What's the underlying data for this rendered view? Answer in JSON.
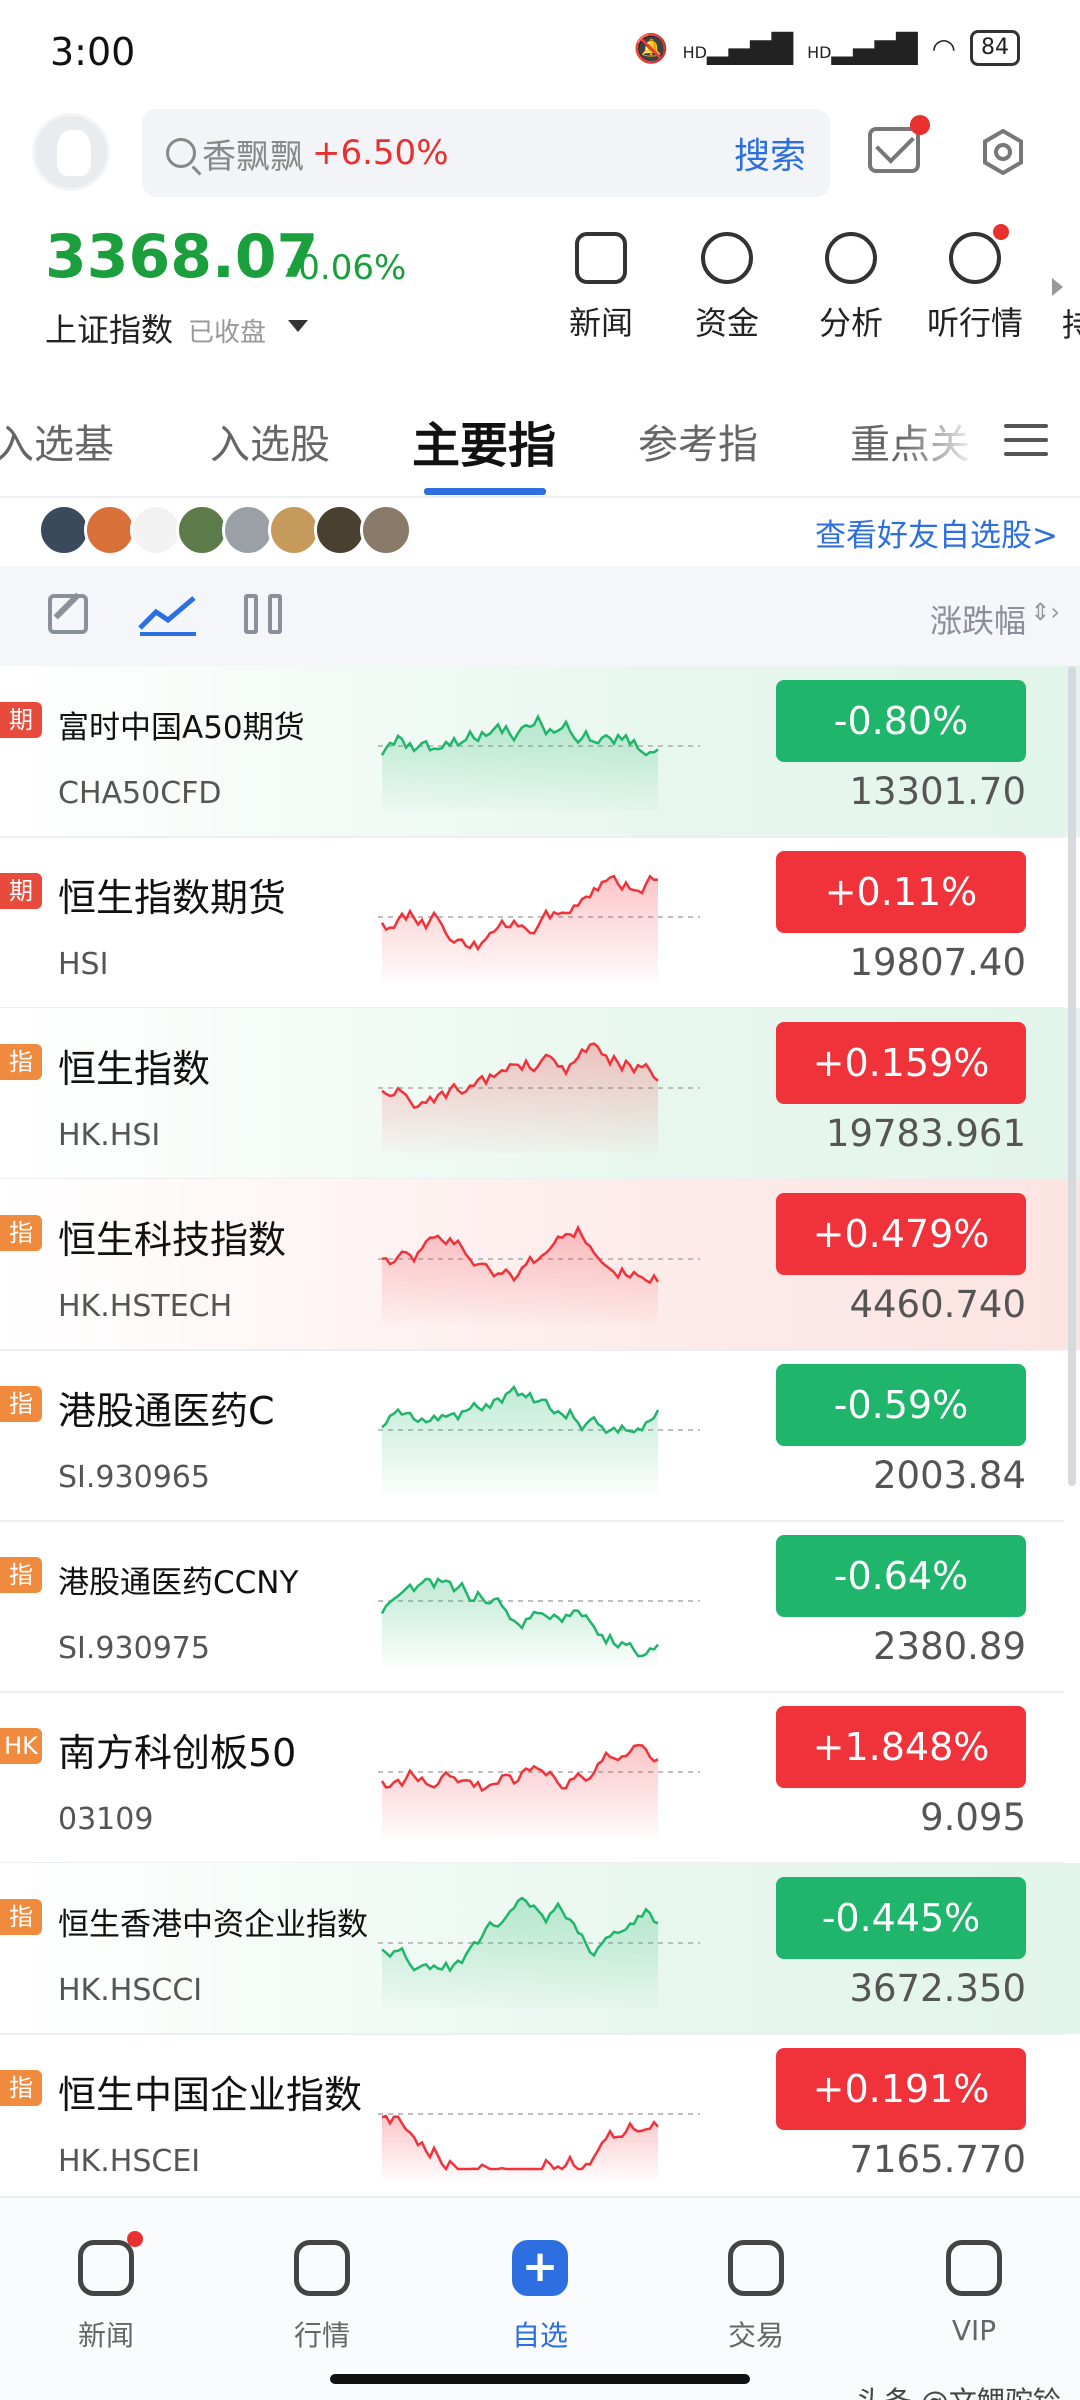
{
  "status_bar": {
    "time": "3:00",
    "battery": "84",
    "network_1": "HD",
    "network_2": "HD"
  },
  "header": {
    "search_hint": "香飘飘",
    "search_hint_change": "+6.50%",
    "search_button": "搜索"
  },
  "index": {
    "value": "3368.07",
    "change": "-0.06%",
    "name": "上证指数",
    "status": "已收盘"
  },
  "quick_actions": [
    {
      "label": "新闻",
      "icon": "news-icon"
    },
    {
      "label": "资金",
      "icon": "fund-icon"
    },
    {
      "label": "分析",
      "icon": "analysis-icon"
    },
    {
      "label": "听行情",
      "icon": "play-icon"
    }
  ],
  "quick_cut_label": "持",
  "tabs": [
    {
      "label": "入选基"
    },
    {
      "label": "入选股"
    },
    {
      "label": "主要指",
      "active": true
    },
    {
      "label": "参考指"
    },
    {
      "label": "重点关"
    }
  ],
  "friends_link": "查看好友自选股>",
  "toolbar": {
    "sort_label": "涨跌幅"
  },
  "colors": {
    "up": "#f0323b",
    "down": "#1fb56b",
    "accent": "#2d6fe0"
  },
  "rows": [
    {
      "tag": "期",
      "name": "富时中国A50期货",
      "code": "CHA50CFD",
      "change": "-0.80%",
      "price": "13301.70",
      "dir": "down",
      "highlight": "green"
    },
    {
      "tag": "期",
      "name": "恒生指数期货",
      "code": "HSI",
      "change": "+0.11%",
      "price": "19807.40",
      "dir": "up",
      "highlight": ""
    },
    {
      "tag": "指",
      "name": "恒生指数",
      "code": "HK.HSI",
      "change": "+0.159%",
      "price": "19783.961",
      "dir": "up",
      "highlight": "green"
    },
    {
      "tag": "指",
      "name": "恒生科技指数",
      "code": "HK.HSTECH",
      "change": "+0.479%",
      "price": "4460.740",
      "dir": "up",
      "highlight": "red"
    },
    {
      "tag": "指",
      "name": "港股通医药C",
      "code": "SI.930965",
      "change": "-0.59%",
      "price": "2003.84",
      "dir": "down",
      "highlight": ""
    },
    {
      "tag": "指",
      "name": "港股通医药CCNY",
      "code": "SI.930975",
      "change": "-0.64%",
      "price": "2380.89",
      "dir": "down",
      "highlight": ""
    },
    {
      "tag": "HK",
      "name": "南方科创板50",
      "code": "03109",
      "change": "+1.848%",
      "price": "9.095",
      "dir": "up",
      "highlight": ""
    },
    {
      "tag": "指",
      "name": "恒生香港中资企业指数",
      "code": "HK.HSCCI",
      "change": "-0.445%",
      "price": "3672.350",
      "dir": "down",
      "highlight": "green"
    },
    {
      "tag": "指",
      "name": "恒生中国企业指数",
      "code": "HK.HSCEI",
      "change": "+0.191%",
      "price": "7165.770",
      "dir": "up",
      "highlight": ""
    }
  ],
  "bottom_nav": [
    {
      "label": "新闻"
    },
    {
      "label": "行情"
    },
    {
      "label": "自选",
      "active": true
    },
    {
      "label": "交易"
    },
    {
      "label": "VIP"
    }
  ],
  "watermark": "头条 @文鲤驼铃"
}
